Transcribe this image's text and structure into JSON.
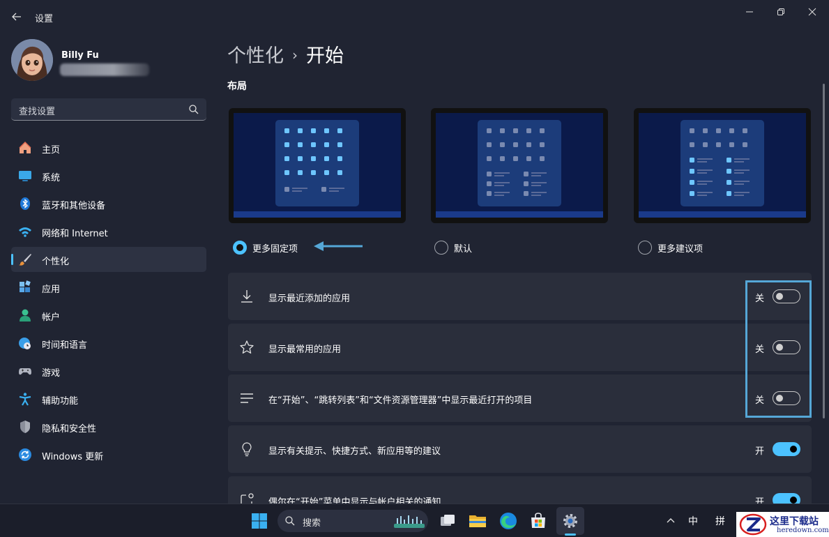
{
  "app": {
    "title": "设置"
  },
  "window_controls": {
    "minimize_icon": "minimize-icon",
    "maximize_icon": "restore-icon",
    "close_icon": "close-icon"
  },
  "user": {
    "name": "Billy Fu",
    "email_blurred": true
  },
  "search": {
    "placeholder": "查找设置"
  },
  "sidebar": {
    "items": [
      {
        "label": "主页",
        "icon": "home-icon"
      },
      {
        "label": "系统",
        "icon": "monitor-icon"
      },
      {
        "label": "蓝牙和其他设备",
        "icon": "bluetooth-icon"
      },
      {
        "label": "网络和 Internet",
        "icon": "wifi-icon"
      },
      {
        "label": "个性化",
        "icon": "brush-icon",
        "active": true
      },
      {
        "label": "应用",
        "icon": "apps-icon"
      },
      {
        "label": "帐户",
        "icon": "account-icon"
      },
      {
        "label": "时间和语言",
        "icon": "globe-clock-icon"
      },
      {
        "label": "游戏",
        "icon": "gamepad-icon"
      },
      {
        "label": "辅助功能",
        "icon": "accessibility-icon"
      },
      {
        "label": "隐私和安全性",
        "icon": "shield-icon"
      },
      {
        "label": "Windows 更新",
        "icon": "update-icon"
      }
    ]
  },
  "breadcrumb": {
    "parent": "个性化",
    "separator": "›",
    "current": "开始"
  },
  "layout": {
    "title": "布局",
    "options": [
      {
        "label": "更多固定项",
        "selected": true
      },
      {
        "label": "默认",
        "selected": false
      },
      {
        "label": "更多建议项",
        "selected": false
      }
    ]
  },
  "settings": [
    {
      "label": "显示最近添加的应用",
      "state": "关",
      "on": false,
      "icon": "download-icon"
    },
    {
      "label": "显示最常用的应用",
      "state": "关",
      "on": false,
      "icon": "star-icon"
    },
    {
      "label": "在“开始”、“跳转列表”和“文件资源管理器”中显示最近打开的项目",
      "state": "关",
      "on": false,
      "icon": "list-icon"
    },
    {
      "label": "显示有关提示、快捷方式、新应用等的建议",
      "state": "开",
      "on": true,
      "icon": "lightbulb-icon"
    },
    {
      "label": "偶尔在“开始”菜单中显示与帐户相关的通知",
      "state": "开",
      "on": true,
      "icon": "notification-icon"
    }
  ],
  "taskbar": {
    "search_label": "搜索",
    "tray": {
      "ime_mode": "中",
      "ime_pinyin": "拼"
    },
    "active_app": "settings"
  },
  "watermark": {
    "title": "这里下载站",
    "subtitle": "heredown.com"
  },
  "colors": {
    "accent": "#4cc2ff",
    "background": "#202432",
    "card": "#2a2e3b",
    "highlight_box": "#55a7d7"
  }
}
